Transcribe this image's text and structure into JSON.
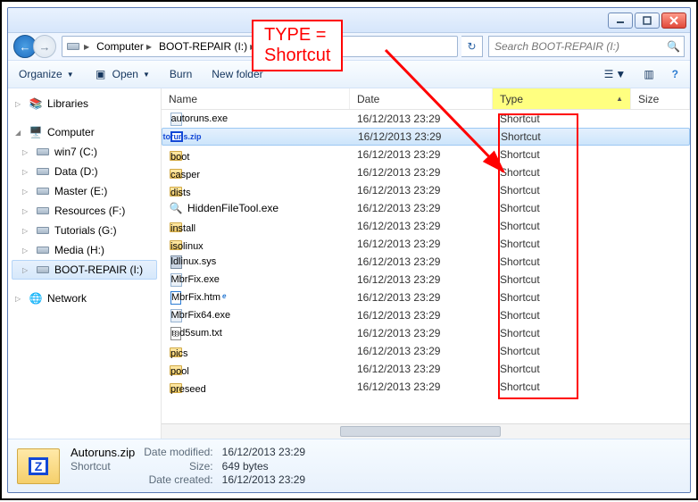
{
  "breadcrumb": {
    "root": "Computer",
    "current": "BOOT-REPAIR (I:)"
  },
  "search_placeholder": "Search BOOT-REPAIR (I:)",
  "toolbar": {
    "organize": "Organize",
    "open": "Open",
    "burn": "Burn",
    "newfolder": "New folder"
  },
  "columns": {
    "name": "Name",
    "date": "Date",
    "type": "Type",
    "size": "Size"
  },
  "nav": {
    "libraries": "Libraries",
    "computer": "Computer",
    "drives": [
      {
        "label": "win7 (C:)"
      },
      {
        "label": "Data (D:)"
      },
      {
        "label": "Master (E:)"
      },
      {
        "label": "Resources (F:)"
      },
      {
        "label": "Tutorials (G:)"
      },
      {
        "label": "Media (H:)"
      },
      {
        "label": "BOOT-REPAIR (I:)",
        "selected": true
      }
    ],
    "network": "Network"
  },
  "files": [
    {
      "name": "autoruns.exe",
      "date": "16/12/2013 23:29",
      "type": "Shortcut",
      "icon": "exe"
    },
    {
      "name": "Autoruns.zip",
      "date": "16/12/2013 23:29",
      "type": "Shortcut",
      "icon": "zip",
      "selected": true
    },
    {
      "name": "boot",
      "date": "16/12/2013 23:29",
      "type": "Shortcut",
      "icon": "folder"
    },
    {
      "name": "casper",
      "date": "16/12/2013 23:29",
      "type": "Shortcut",
      "icon": "folder"
    },
    {
      "name": "dists",
      "date": "16/12/2013 23:29",
      "type": "Shortcut",
      "icon": "folder"
    },
    {
      "name": "HiddenFileTool.exe",
      "date": "16/12/2013 23:29",
      "type": "Shortcut",
      "icon": "search"
    },
    {
      "name": "install",
      "date": "16/12/2013 23:29",
      "type": "Shortcut",
      "icon": "folder"
    },
    {
      "name": "isolinux",
      "date": "16/12/2013 23:29",
      "type": "Shortcut",
      "icon": "folder"
    },
    {
      "name": "ldlinux.sys",
      "date": "16/12/2013 23:29",
      "type": "Shortcut",
      "icon": "sys"
    },
    {
      "name": "MbrFix.exe",
      "date": "16/12/2013 23:29",
      "type": "Shortcut",
      "icon": "exe"
    },
    {
      "name": "MbrFix.htm",
      "date": "16/12/2013 23:29",
      "type": "Shortcut",
      "icon": "htm"
    },
    {
      "name": "MbrFix64.exe",
      "date": "16/12/2013 23:29",
      "type": "Shortcut",
      "icon": "exe"
    },
    {
      "name": "md5sum.txt",
      "date": "16/12/2013 23:29",
      "type": "Shortcut",
      "icon": "txt"
    },
    {
      "name": "pics",
      "date": "16/12/2013 23:29",
      "type": "Shortcut",
      "icon": "folder"
    },
    {
      "name": "pool",
      "date": "16/12/2013 23:29",
      "type": "Shortcut",
      "icon": "folder"
    },
    {
      "name": "preseed",
      "date": "16/12/2013 23:29",
      "type": "Shortcut",
      "icon": "folder"
    }
  ],
  "details": {
    "name": "Autoruns.zip",
    "kind": "Shortcut",
    "modified_label": "Date modified:",
    "modified": "16/12/2013 23:29",
    "size_label": "Size:",
    "size": "649 bytes",
    "created_label": "Date created:",
    "created": "16/12/2013 23:29"
  },
  "annotation": {
    "label": "TYPE = Shortcut"
  }
}
